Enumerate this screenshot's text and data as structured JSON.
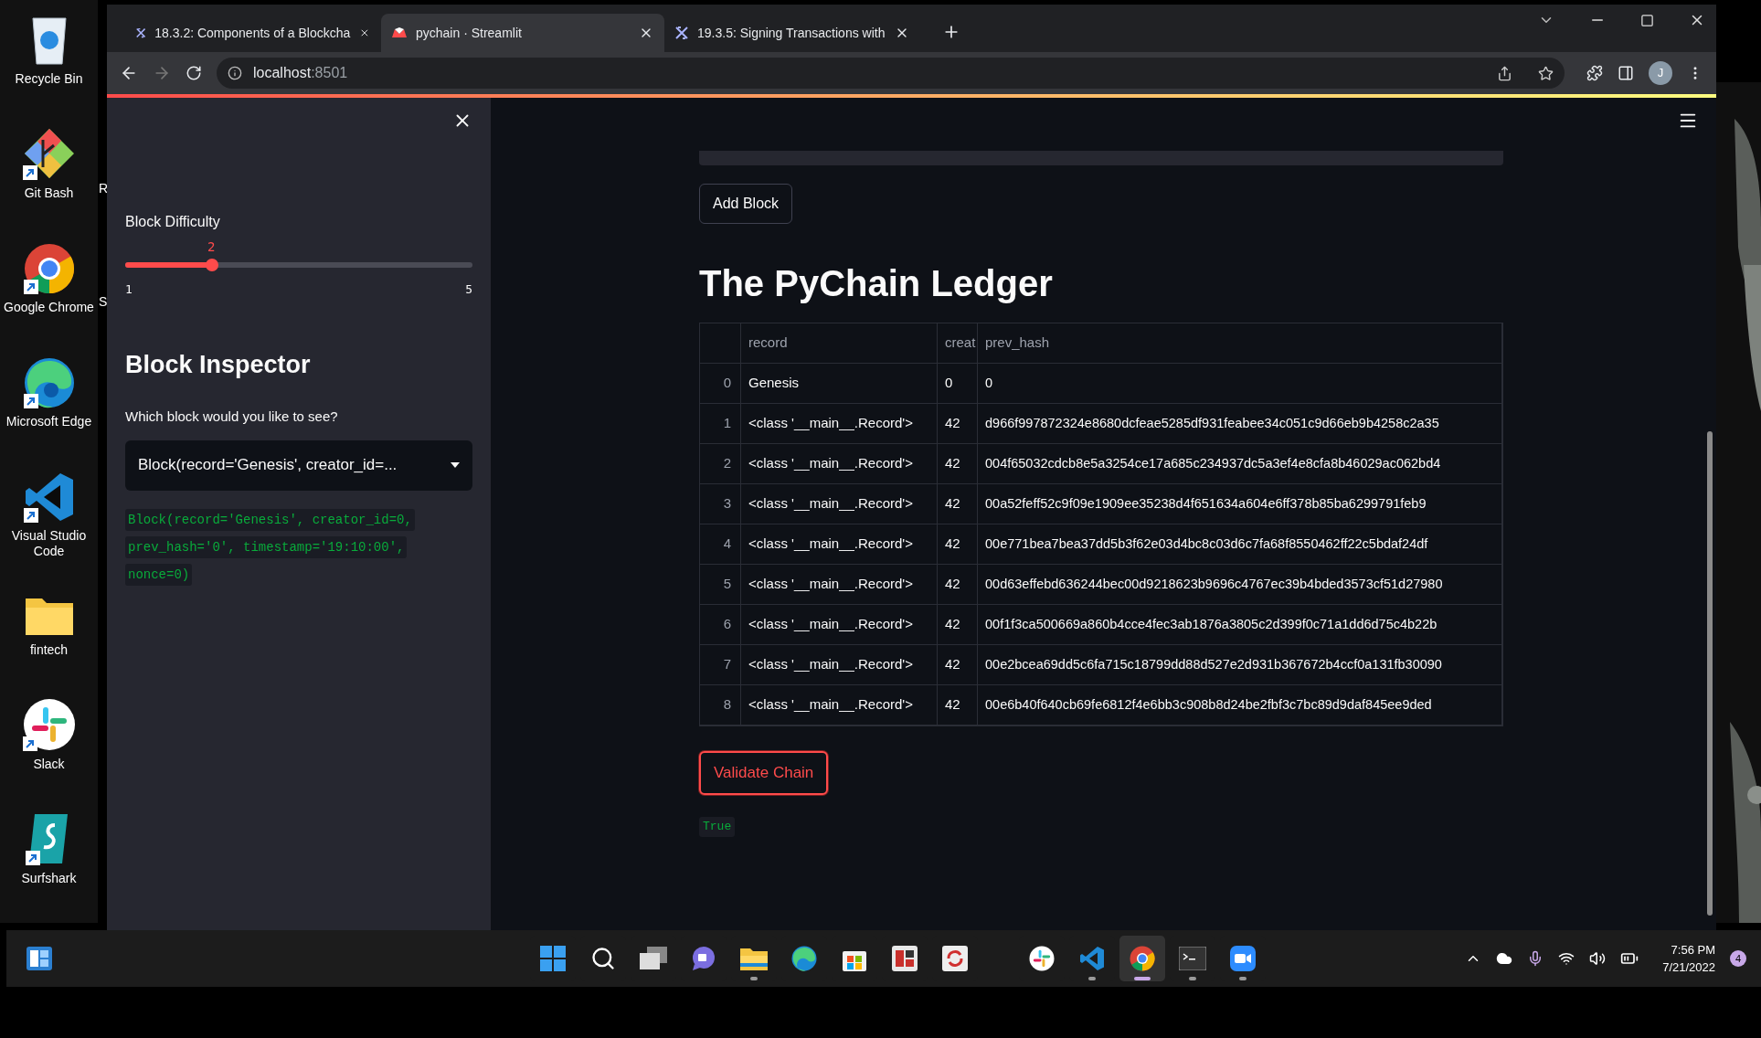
{
  "desktop": {
    "icons": [
      {
        "kind": "recycle",
        "label": "Recycle Bin",
        "shortcut": false
      },
      {
        "kind": "gitbash",
        "label": "Git Bash",
        "shortcut": true
      },
      {
        "kind": "chrome",
        "label": "Google Chrome",
        "shortcut": true
      },
      {
        "kind": "edge",
        "label": "Microsoft Edge",
        "shortcut": true
      },
      {
        "kind": "vscode",
        "label": "Visual Studio Code",
        "shortcut": true
      },
      {
        "kind": "folder",
        "label": "fintech",
        "shortcut": false
      },
      {
        "kind": "slack",
        "label": "Slack",
        "shortcut": true
      },
      {
        "kind": "surfshark",
        "label": "Surfshark",
        "shortcut": true
      }
    ],
    "second_column_labels": [
      "R",
      "S"
    ]
  },
  "browser": {
    "tabs": [
      {
        "title": "18.3.2: Components of a Blockcha",
        "selected": false,
        "kind": "course"
      },
      {
        "title": "pychain · Streamlit",
        "selected": true,
        "kind": "streamlit"
      },
      {
        "title": "19.3.5: Signing Transactions with",
        "selected": false,
        "kind": "course"
      }
    ],
    "address": {
      "host": "localhost",
      "port": ":8501"
    },
    "profile_initial": "J"
  },
  "sidebar": {
    "slider": {
      "label": "Block Difficulty",
      "value": "2",
      "min": "1",
      "max": "5",
      "level": 0.25
    },
    "heading": "Block Inspector",
    "select": {
      "label": "Which block would you like to see?",
      "value": "Block(record='Genesis', creator_id=..."
    },
    "code_lines": [
      "Block(record='Genesis', creator_id=0,",
      "prev_hash='0', timestamp='19:10:00',",
      "nonce=0)"
    ]
  },
  "main": {
    "add_button": "Add Block",
    "title": "The PyChain Ledger",
    "table": {
      "columns": [
        "record",
        "creat",
        "prev_hash"
      ],
      "rows": [
        {
          "index": "0",
          "record": "Genesis",
          "creator": "0",
          "prev_hash": "0"
        },
        {
          "index": "1",
          "record": "<class '__main__.Record'>",
          "creator": "42",
          "prev_hash": "d966f997872324e8680dcfeae5285df931feabee34c051c9d66eb9b4258c2a35"
        },
        {
          "index": "2",
          "record": "<class '__main__.Record'>",
          "creator": "42",
          "prev_hash": "004f65032cdcb8e5a3254ce17a685c234937dc5a3ef4e8cfa8b46029ac062bd4"
        },
        {
          "index": "3",
          "record": "<class '__main__.Record'>",
          "creator": "42",
          "prev_hash": "00a52feff52c9f09e1909ee35238d4f651634a604e6ff378b85ba6299791feb9"
        },
        {
          "index": "4",
          "record": "<class '__main__.Record'>",
          "creator": "42",
          "prev_hash": "00e771bea7bea37dd5b3f62e03d4bc8c03d6c7fa68f8550462ff22c5bdaf24df"
        },
        {
          "index": "5",
          "record": "<class '__main__.Record'>",
          "creator": "42",
          "prev_hash": "00d63effebd636244bec00d9218623b9696c4767ec39b4bded3573cf51d27980"
        },
        {
          "index": "6",
          "record": "<class '__main__.Record'>",
          "creator": "42",
          "prev_hash": "00f1f3ca500669a860b4cce4fec3ab1876a3805c2d399f0c71a1dd6d75c4b22b"
        },
        {
          "index": "7",
          "record": "<class '__main__.Record'>",
          "creator": "42",
          "prev_hash": "00e2bcea69dd5c6fa715c18799dd88d527e2d931b367672b4ccf0a131fb30090"
        },
        {
          "index": "8",
          "record": "<class '__main__.Record'>",
          "creator": "42",
          "prev_hash": "00e6b40f640cb69fe6812f4e6bb3c908b8d24be2fbf3c7bc89d9daf845ee9ded"
        }
      ]
    },
    "validate_button": "Validate Chain",
    "result": "True"
  },
  "taskbar": {
    "pinned": [
      {
        "kind": "start",
        "running": false,
        "selected": false
      },
      {
        "kind": "search",
        "running": false,
        "selected": false
      },
      {
        "kind": "taskview",
        "running": false,
        "selected": false
      },
      {
        "kind": "chat",
        "running": false,
        "selected": false
      },
      {
        "kind": "explorer",
        "running": true,
        "selected": false
      },
      {
        "kind": "edge",
        "running": false,
        "selected": false
      },
      {
        "kind": "store",
        "running": false,
        "selected": false
      },
      {
        "kind": "redapp",
        "running": false,
        "selected": false
      },
      {
        "kind": "sync",
        "running": false,
        "selected": false
      }
    ],
    "apps": [
      {
        "kind": "slack",
        "running": false,
        "selected": false
      },
      {
        "kind": "vscode",
        "running": true,
        "selected": false
      },
      {
        "kind": "chrome",
        "running": true,
        "selected": true
      },
      {
        "kind": "terminal",
        "running": true,
        "selected": false
      },
      {
        "kind": "zoom",
        "running": true,
        "selected": false
      }
    ],
    "time": "7:56 PM",
    "date": "7/21/2022",
    "notifications": "4"
  }
}
